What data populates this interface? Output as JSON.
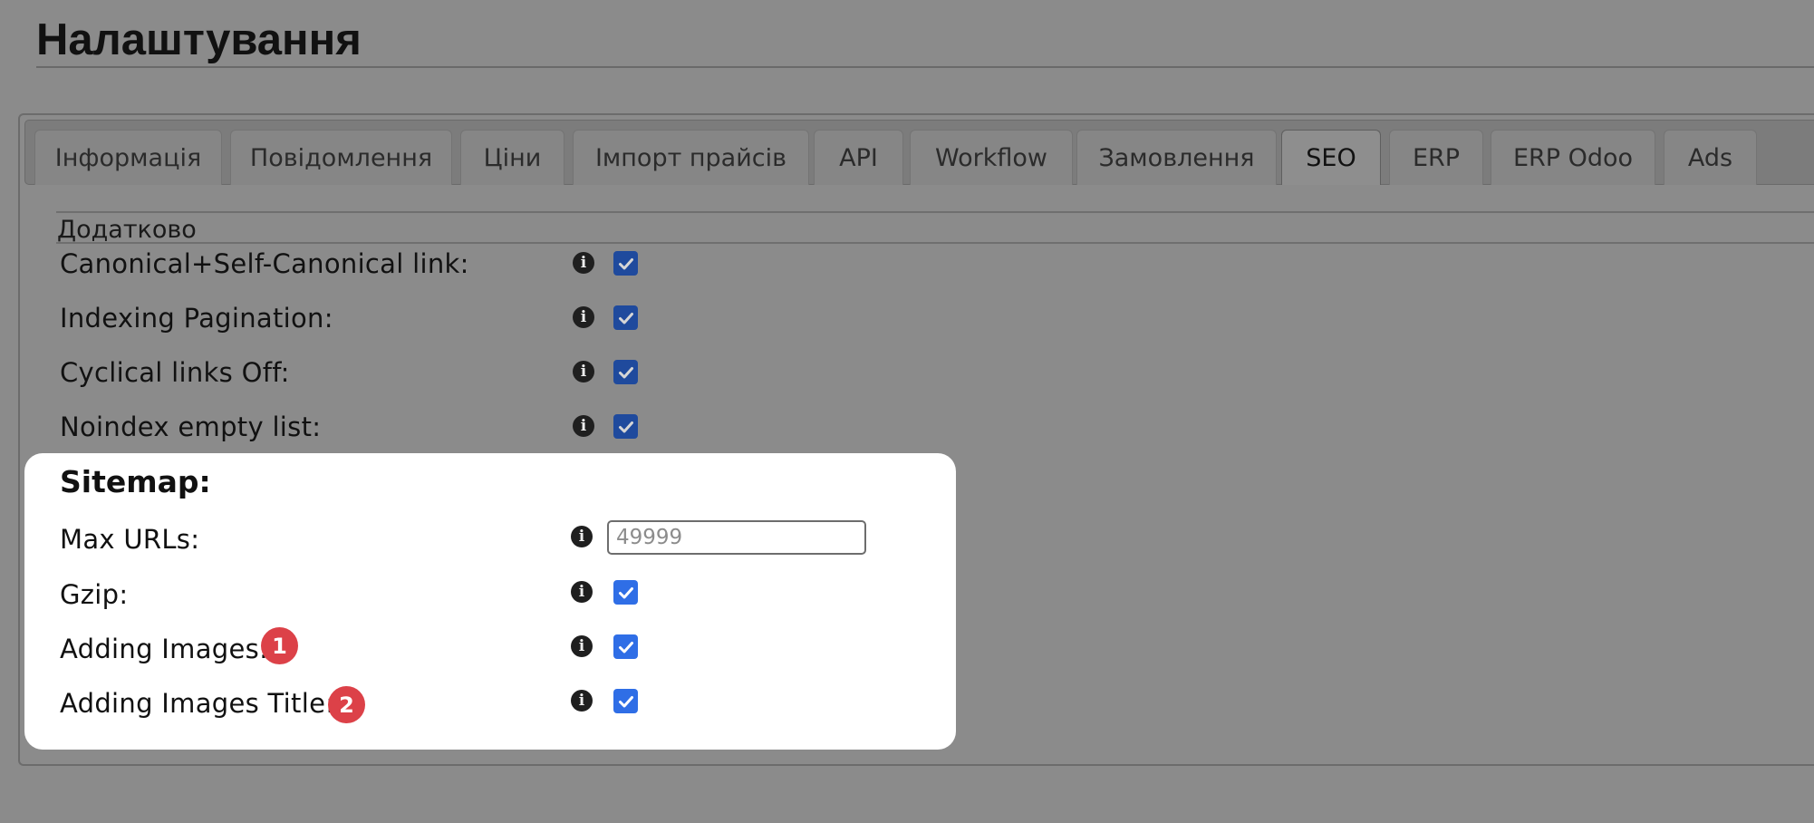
{
  "page": {
    "title": "Налаштування"
  },
  "tabs": [
    {
      "label": "Інформація"
    },
    {
      "label": "Повідомлення"
    },
    {
      "label": "Ціни"
    },
    {
      "label": "Імпорт прайсів"
    },
    {
      "label": "API"
    },
    {
      "label": "Workflow"
    },
    {
      "label": "Замовлення"
    },
    {
      "label": "SEO",
      "active": true
    },
    {
      "label": "ERP"
    },
    {
      "label": "ERP Odoo"
    },
    {
      "label": "Ads"
    }
  ],
  "additional": {
    "legend": "Додатково",
    "rows": [
      {
        "label": "Canonical+Self-Canonical link:",
        "checked": true
      },
      {
        "label": "Indexing Pagination:",
        "checked": true
      },
      {
        "label": "Cyclical links Off:",
        "checked": true
      },
      {
        "label": "Noindex empty list:",
        "checked": true
      }
    ]
  },
  "sitemap": {
    "heading": "Sitemap:",
    "max_urls": {
      "label": "Max URLs:",
      "placeholder": "49999",
      "value": ""
    },
    "gzip": {
      "label": "Gzip:",
      "checked": true
    },
    "adding_images": {
      "label": "Adding Images:",
      "checked": true,
      "badge": "1"
    },
    "adding_images_title": {
      "label": "Adding Images Title:",
      "checked": true,
      "badge": "2"
    }
  },
  "info_icon_glyph": "i",
  "icons": {
    "info": "info-circle-icon",
    "check": "checkmark-icon"
  },
  "colors": {
    "background": "#8b8b8b",
    "checkbox_dim": "#1f4a9d",
    "checkbox_bright": "#2f6ee6",
    "badge": "#dc4148",
    "highlight": "#ffffff"
  }
}
